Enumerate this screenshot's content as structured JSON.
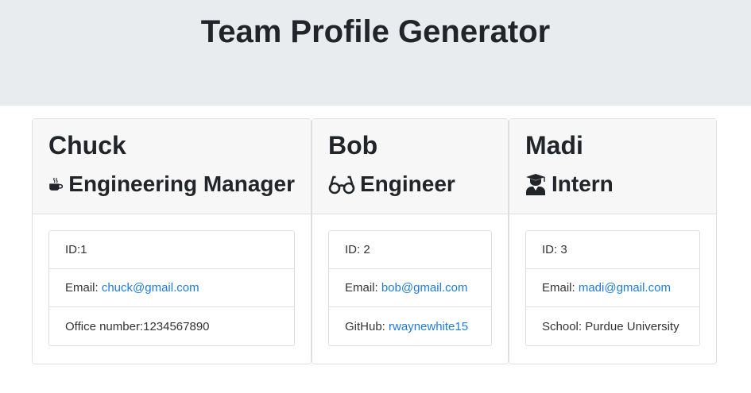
{
  "header": {
    "title": "Team Profile Generator"
  },
  "cards": [
    {
      "name": "Chuck",
      "role": "Engineering Manager",
      "role_icon": "coffee-mug-icon",
      "items": [
        {
          "text": "ID:1"
        },
        {
          "label": "Email: ",
          "link": "chuck@gmail.com"
        },
        {
          "text": "Office number:1234567890"
        }
      ]
    },
    {
      "name": "Bob",
      "role": "Engineer",
      "role_icon": "glasses-icon",
      "items": [
        {
          "text": "ID: 2"
        },
        {
          "label": "Email: ",
          "link": "bob@gmail.com"
        },
        {
          "label": "GitHub: ",
          "link": "rwaynewhite15"
        }
      ]
    },
    {
      "name": "Madi",
      "role": "Intern",
      "role_icon": "graduate-icon",
      "items": [
        {
          "text": "ID: 3"
        },
        {
          "label": "Email: ",
          "link": "madi@gmail.com"
        },
        {
          "text": "School: Purdue University"
        }
      ]
    }
  ],
  "colors": {
    "header_bg": "#e9ecef",
    "card_header_bg": "#f7f7f7",
    "link": "#1f7bd9"
  }
}
